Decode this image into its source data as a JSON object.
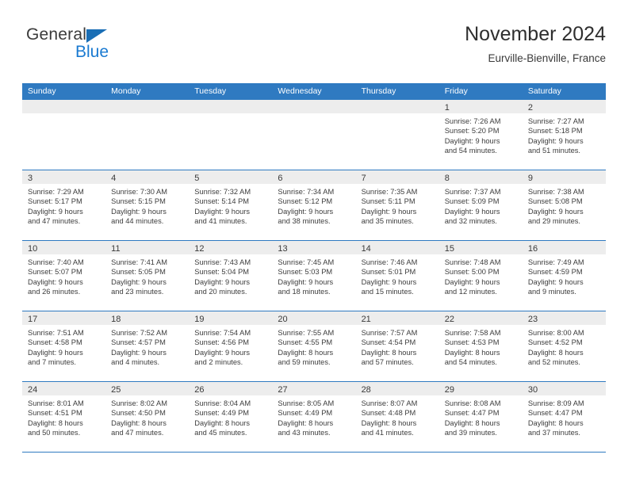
{
  "logo": {
    "word_general": "General",
    "word_blue": "Blue",
    "triangle_color": "#1a6eb5",
    "blue_color": "#1a7ad1"
  },
  "header": {
    "title": "November 2024",
    "subtitle": "Eurville-Bienville, France"
  },
  "theme": {
    "header_bg": "#2f7ac1",
    "header_text": "#ffffff",
    "daynum_band_bg": "#ededed",
    "cell_bg": "#ffffff",
    "body_text": "#3d3d3d"
  },
  "weekdays": [
    "Sunday",
    "Monday",
    "Tuesday",
    "Wednesday",
    "Thursday",
    "Friday",
    "Saturday"
  ],
  "weeks": [
    [
      {
        "day": "",
        "empty": true
      },
      {
        "day": "",
        "empty": true
      },
      {
        "day": "",
        "empty": true
      },
      {
        "day": "",
        "empty": true
      },
      {
        "day": "",
        "empty": true
      },
      {
        "day": "1",
        "sunrise": "Sunrise: 7:26 AM",
        "sunset": "Sunset: 5:20 PM",
        "daylight1": "Daylight: 9 hours",
        "daylight2": "and 54 minutes."
      },
      {
        "day": "2",
        "sunrise": "Sunrise: 7:27 AM",
        "sunset": "Sunset: 5:18 PM",
        "daylight1": "Daylight: 9 hours",
        "daylight2": "and 51 minutes."
      }
    ],
    [
      {
        "day": "3",
        "sunrise": "Sunrise: 7:29 AM",
        "sunset": "Sunset: 5:17 PM",
        "daylight1": "Daylight: 9 hours",
        "daylight2": "and 47 minutes."
      },
      {
        "day": "4",
        "sunrise": "Sunrise: 7:30 AM",
        "sunset": "Sunset: 5:15 PM",
        "daylight1": "Daylight: 9 hours",
        "daylight2": "and 44 minutes."
      },
      {
        "day": "5",
        "sunrise": "Sunrise: 7:32 AM",
        "sunset": "Sunset: 5:14 PM",
        "daylight1": "Daylight: 9 hours",
        "daylight2": "and 41 minutes."
      },
      {
        "day": "6",
        "sunrise": "Sunrise: 7:34 AM",
        "sunset": "Sunset: 5:12 PM",
        "daylight1": "Daylight: 9 hours",
        "daylight2": "and 38 minutes."
      },
      {
        "day": "7",
        "sunrise": "Sunrise: 7:35 AM",
        "sunset": "Sunset: 5:11 PM",
        "daylight1": "Daylight: 9 hours",
        "daylight2": "and 35 minutes."
      },
      {
        "day": "8",
        "sunrise": "Sunrise: 7:37 AM",
        "sunset": "Sunset: 5:09 PM",
        "daylight1": "Daylight: 9 hours",
        "daylight2": "and 32 minutes."
      },
      {
        "day": "9",
        "sunrise": "Sunrise: 7:38 AM",
        "sunset": "Sunset: 5:08 PM",
        "daylight1": "Daylight: 9 hours",
        "daylight2": "and 29 minutes."
      }
    ],
    [
      {
        "day": "10",
        "sunrise": "Sunrise: 7:40 AM",
        "sunset": "Sunset: 5:07 PM",
        "daylight1": "Daylight: 9 hours",
        "daylight2": "and 26 minutes."
      },
      {
        "day": "11",
        "sunrise": "Sunrise: 7:41 AM",
        "sunset": "Sunset: 5:05 PM",
        "daylight1": "Daylight: 9 hours",
        "daylight2": "and 23 minutes."
      },
      {
        "day": "12",
        "sunrise": "Sunrise: 7:43 AM",
        "sunset": "Sunset: 5:04 PM",
        "daylight1": "Daylight: 9 hours",
        "daylight2": "and 20 minutes."
      },
      {
        "day": "13",
        "sunrise": "Sunrise: 7:45 AM",
        "sunset": "Sunset: 5:03 PM",
        "daylight1": "Daylight: 9 hours",
        "daylight2": "and 18 minutes."
      },
      {
        "day": "14",
        "sunrise": "Sunrise: 7:46 AM",
        "sunset": "Sunset: 5:01 PM",
        "daylight1": "Daylight: 9 hours",
        "daylight2": "and 15 minutes."
      },
      {
        "day": "15",
        "sunrise": "Sunrise: 7:48 AM",
        "sunset": "Sunset: 5:00 PM",
        "daylight1": "Daylight: 9 hours",
        "daylight2": "and 12 minutes."
      },
      {
        "day": "16",
        "sunrise": "Sunrise: 7:49 AM",
        "sunset": "Sunset: 4:59 PM",
        "daylight1": "Daylight: 9 hours",
        "daylight2": "and 9 minutes."
      }
    ],
    [
      {
        "day": "17",
        "sunrise": "Sunrise: 7:51 AM",
        "sunset": "Sunset: 4:58 PM",
        "daylight1": "Daylight: 9 hours",
        "daylight2": "and 7 minutes."
      },
      {
        "day": "18",
        "sunrise": "Sunrise: 7:52 AM",
        "sunset": "Sunset: 4:57 PM",
        "daylight1": "Daylight: 9 hours",
        "daylight2": "and 4 minutes."
      },
      {
        "day": "19",
        "sunrise": "Sunrise: 7:54 AM",
        "sunset": "Sunset: 4:56 PM",
        "daylight1": "Daylight: 9 hours",
        "daylight2": "and 2 minutes."
      },
      {
        "day": "20",
        "sunrise": "Sunrise: 7:55 AM",
        "sunset": "Sunset: 4:55 PM",
        "daylight1": "Daylight: 8 hours",
        "daylight2": "and 59 minutes."
      },
      {
        "day": "21",
        "sunrise": "Sunrise: 7:57 AM",
        "sunset": "Sunset: 4:54 PM",
        "daylight1": "Daylight: 8 hours",
        "daylight2": "and 57 minutes."
      },
      {
        "day": "22",
        "sunrise": "Sunrise: 7:58 AM",
        "sunset": "Sunset: 4:53 PM",
        "daylight1": "Daylight: 8 hours",
        "daylight2": "and 54 minutes."
      },
      {
        "day": "23",
        "sunrise": "Sunrise: 8:00 AM",
        "sunset": "Sunset: 4:52 PM",
        "daylight1": "Daylight: 8 hours",
        "daylight2": "and 52 minutes."
      }
    ],
    [
      {
        "day": "24",
        "sunrise": "Sunrise: 8:01 AM",
        "sunset": "Sunset: 4:51 PM",
        "daylight1": "Daylight: 8 hours",
        "daylight2": "and 50 minutes."
      },
      {
        "day": "25",
        "sunrise": "Sunrise: 8:02 AM",
        "sunset": "Sunset: 4:50 PM",
        "daylight1": "Daylight: 8 hours",
        "daylight2": "and 47 minutes."
      },
      {
        "day": "26",
        "sunrise": "Sunrise: 8:04 AM",
        "sunset": "Sunset: 4:49 PM",
        "daylight1": "Daylight: 8 hours",
        "daylight2": "and 45 minutes."
      },
      {
        "day": "27",
        "sunrise": "Sunrise: 8:05 AM",
        "sunset": "Sunset: 4:49 PM",
        "daylight1": "Daylight: 8 hours",
        "daylight2": "and 43 minutes."
      },
      {
        "day": "28",
        "sunrise": "Sunrise: 8:07 AM",
        "sunset": "Sunset: 4:48 PM",
        "daylight1": "Daylight: 8 hours",
        "daylight2": "and 41 minutes."
      },
      {
        "day": "29",
        "sunrise": "Sunrise: 8:08 AM",
        "sunset": "Sunset: 4:47 PM",
        "daylight1": "Daylight: 8 hours",
        "daylight2": "and 39 minutes."
      },
      {
        "day": "30",
        "sunrise": "Sunrise: 8:09 AM",
        "sunset": "Sunset: 4:47 PM",
        "daylight1": "Daylight: 8 hours",
        "daylight2": "and 37 minutes."
      }
    ]
  ]
}
